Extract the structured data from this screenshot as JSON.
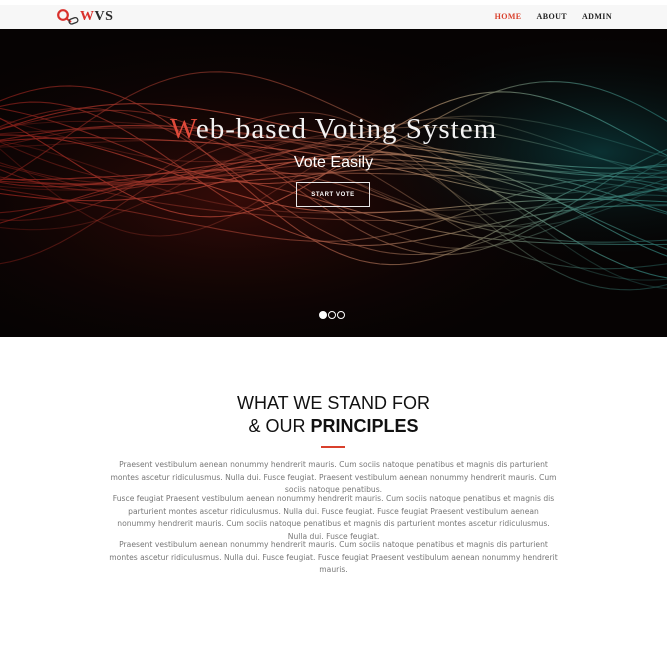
{
  "nav": {
    "logo_text_part1": "W",
    "logo_text_part2": "VS",
    "links": [
      {
        "label": "HOME",
        "active": true
      },
      {
        "label": "ABOUT",
        "active": false
      },
      {
        "label": "ADMIN",
        "active": false
      }
    ]
  },
  "hero": {
    "title_first_letter": "W",
    "title_rest": "eb-based Voting System",
    "subtitle": "Vote Easily",
    "button_label": "START VOTE",
    "slides": 3,
    "active_slide": 1
  },
  "principles": {
    "heading_line1": "WHAT WE STAND FOR",
    "heading_line2_prefix": "& OUR ",
    "heading_line2_bold": "PRINCIPLES",
    "paragraphs": [
      "Praesent vestibulum aenean nonummy hendrerit mauris. Cum sociis natoque penatibus et magnis dis parturient montes ascetur ridiculusmus. Nulla dui. Fusce feugiat. Praesent vestibulum aenean nonummy hendrerit mauris. Cum sociis natoque penatibus.",
      "Fusce feugiat Praesent vestibulum aenean nonummy hendrerit mauris. Cum sociis natoque penatibus et magnis dis parturient montes ascetur ridiculusmus. Nulla dui. Fusce feugiat. Fusce feugiat Praesent vestibulum aenean nonummy hendrerit mauris. Cum sociis natoque penatibus et magnis dis parturient montes ascetur ridiculusmus. Nulla dui. Fusce feugiat.",
      "Praesent vestibulum aenean nonummy hendrerit mauris. Cum sociis natoque penatibus et magnis dis parturient montes ascetur ridiculusmus. Nulla dui. Fusce feugiat. Fusce feugiat Praesent vestibulum aenean nonummy hendrerit mauris."
    ]
  },
  "colors": {
    "accent": "#d9402c",
    "hero_background": "#060303",
    "paragraph_text": "#777777"
  },
  "icons": {
    "logo": "magnifier-link-icon"
  }
}
